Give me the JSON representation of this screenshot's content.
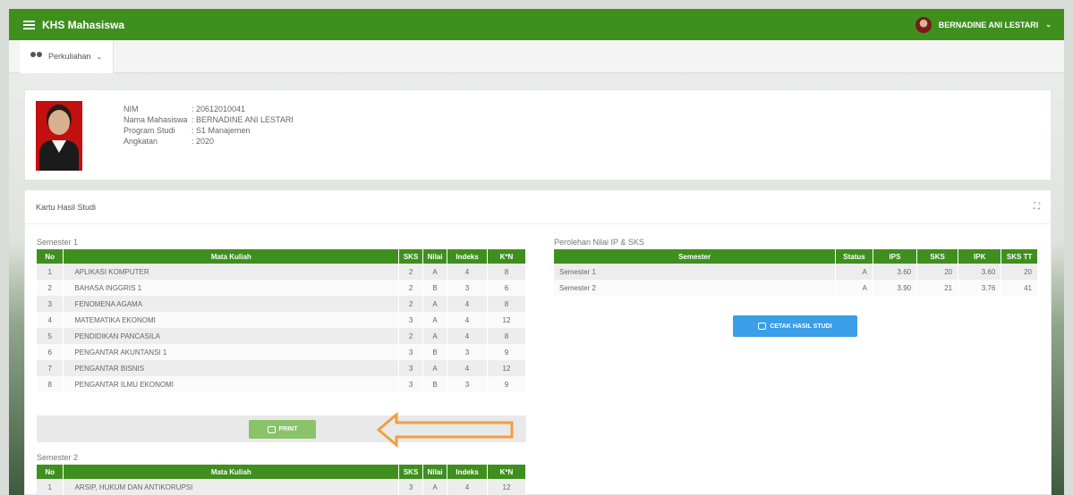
{
  "topbar": {
    "app_title": "KHS Mahasiswa",
    "user_name": "BERNADINE ANI LESTARI",
    "caret": "⌄"
  },
  "subnav": {
    "menu_label": "Perkuliahan",
    "caret": "⌄"
  },
  "profile": {
    "fields": [
      {
        "label": "NIM",
        "value": ": 20612010041"
      },
      {
        "label": "Nama Mahasiswa",
        "value": ": BERNADINE ANI LESTARI"
      },
      {
        "label": "Program Studi",
        "value": ": S1 Manajemen"
      },
      {
        "label": "Angkatan",
        "value": ": 2020"
      }
    ]
  },
  "card": {
    "title": "Kartu Hasil Studi",
    "expand_icon": "⛶"
  },
  "semester1": {
    "label": "Semester 1",
    "headers": [
      "No",
      "Mata Kuliah",
      "SKS",
      "Nilai",
      "Indeks",
      "K*N"
    ],
    "rows": [
      [
        "1",
        "APLIKASI KOMPUTER",
        "2",
        "A",
        "4",
        "8"
      ],
      [
        "2",
        "BAHASA INGGRIS 1",
        "2",
        "B",
        "3",
        "6"
      ],
      [
        "3",
        "FENOMENA AGAMA",
        "2",
        "A",
        "4",
        "8"
      ],
      [
        "4",
        "MATEMATIKA EKONOMI",
        "3",
        "A",
        "4",
        "12"
      ],
      [
        "5",
        "PENDIDIKAN PANCASILA",
        "2",
        "A",
        "4",
        "8"
      ],
      [
        "6",
        "PENGANTAR AKUNTANSI 1",
        "3",
        "B",
        "3",
        "9"
      ],
      [
        "7",
        "PENGANTAR BISNIS",
        "3",
        "A",
        "4",
        "12"
      ],
      [
        "8",
        "PENGANTAR ILMU EKONOMI",
        "3",
        "B",
        "3",
        "9"
      ]
    ],
    "print_label": "PRINT"
  },
  "semester2": {
    "label": "Semester 2",
    "headers": [
      "No",
      "Mata Kuliah",
      "SKS",
      "Nilai",
      "Indeks",
      "K*N"
    ],
    "rows": [
      [
        "1",
        "ARSIP, HUKUM DAN ANTIKORUPSI",
        "3",
        "A",
        "4",
        "12"
      ]
    ]
  },
  "ip_section": {
    "label": "Perolehan Nilai IP & SKS",
    "headers": [
      "Semester",
      "Status",
      "IPS",
      "SKS",
      "IPK",
      "SKS TT"
    ],
    "rows": [
      [
        "Semester 1",
        "A",
        "3.60",
        "20",
        "3.60",
        "20"
      ],
      [
        "Semester 2",
        "A",
        "3.90",
        "21",
        "3.76",
        "41"
      ]
    ],
    "cetak_label": "CETAK HASIL STUDI"
  },
  "colors": {
    "primary_green": "#3f8f1f",
    "print_button": "#8bc36a",
    "cetak_button": "#3a9ee8",
    "annotation_arrow": "#f0a040"
  }
}
